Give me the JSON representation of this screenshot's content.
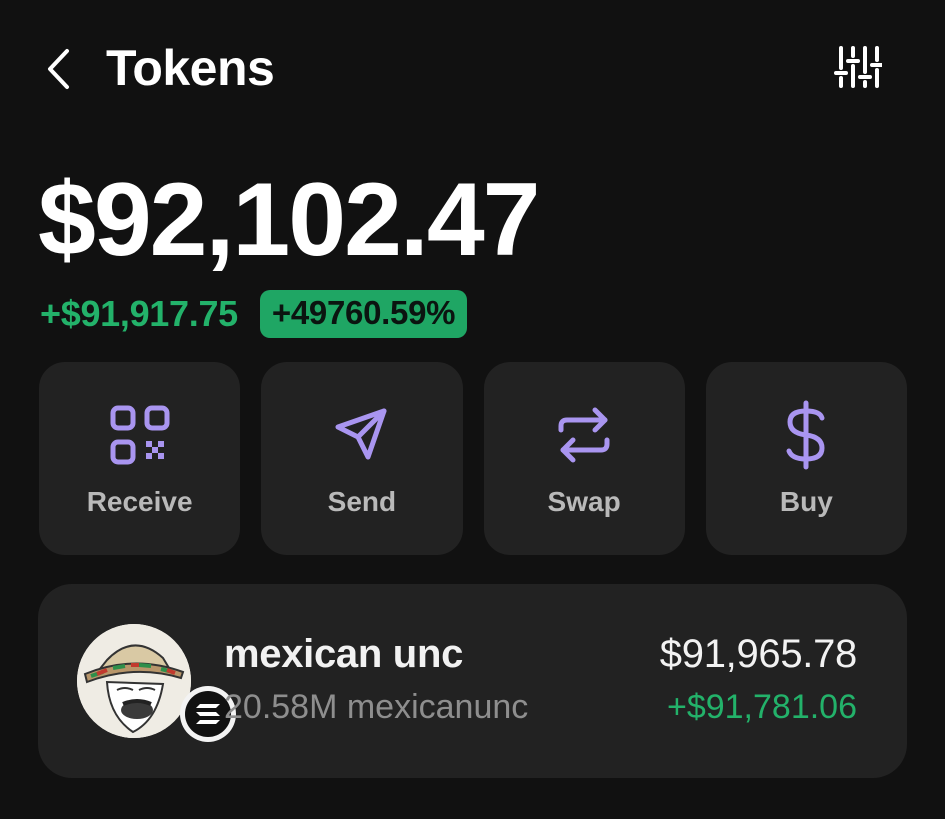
{
  "header": {
    "title": "Tokens"
  },
  "portfolio": {
    "balance": "$92,102.47",
    "change_amount": "+$91,917.75",
    "change_percent": "+49760.59%"
  },
  "actions": [
    {
      "label": "Receive",
      "icon": "qr-code-icon"
    },
    {
      "label": "Send",
      "icon": "send-icon"
    },
    {
      "label": "Swap",
      "icon": "swap-icon"
    },
    {
      "label": "Buy",
      "icon": "dollar-icon"
    }
  ],
  "tokens": [
    {
      "name": "mexican unc",
      "amount": "20.58M mexicanunc",
      "value": "$91,965.78",
      "change": "+$91,781.06",
      "chain_icon": "solana-icon"
    }
  ],
  "colors": {
    "background": "#111111",
    "card": "#222222",
    "accent": "#a995f0",
    "positive": "#23b26a"
  }
}
